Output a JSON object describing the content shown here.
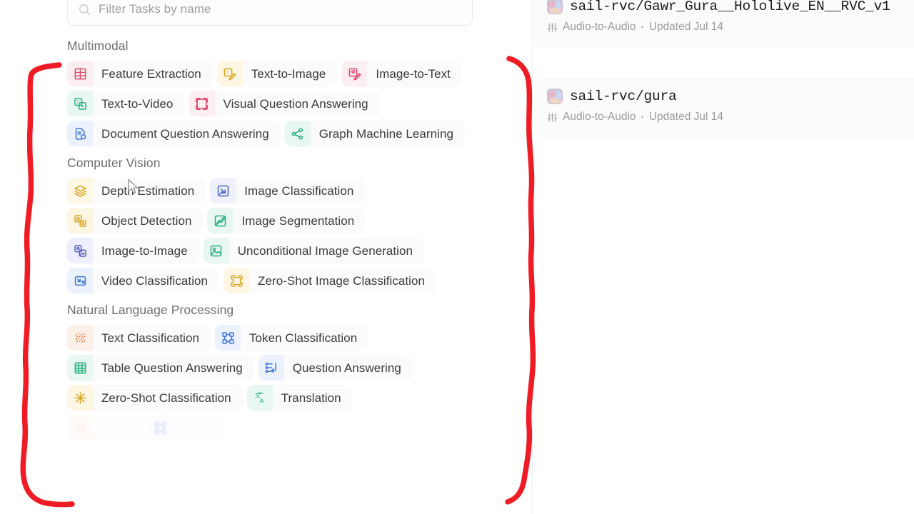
{
  "search": {
    "placeholder": "Filter Tasks by name",
    "value": "",
    "icon": "search-icon"
  },
  "groups": [
    {
      "title": "Multimodal",
      "rows": [
        [
          {
            "label": "Feature Extraction",
            "icon": "table-grid-icon",
            "color": "#d94f6e",
            "bg": "#fceef1"
          },
          {
            "label": "Text-to-Image",
            "icon": "text-to-image-icon",
            "color": "#d9a521",
            "bg": "#fdf6e3"
          },
          {
            "label": "Image-to-Text",
            "icon": "image-to-text-icon",
            "color": "#e0426a",
            "bg": "#fdeef2"
          }
        ],
        [
          {
            "label": "Text-to-Video",
            "icon": "text-to-video-icon",
            "color": "#23b07a",
            "bg": "#e8f8f1"
          },
          {
            "label": "Visual Question Answering",
            "icon": "visual-qa-icon",
            "color": "#e0426a",
            "bg": "#fdeef2"
          }
        ],
        [
          {
            "label": "Document Question Answering",
            "icon": "document-qa-icon",
            "color": "#3f74d6",
            "bg": "#ecf2fd"
          },
          {
            "label": "Graph Machine Learning",
            "icon": "graph-ml-icon",
            "color": "#23b07a",
            "bg": "#e8f8f1"
          }
        ]
      ]
    },
    {
      "title": "Computer Vision",
      "rows": [
        [
          {
            "label": "Depth Estimation",
            "icon": "layers-icon",
            "color": "#e0a21c",
            "bg": "#fdf7e6"
          },
          {
            "label": "Image Classification",
            "icon": "image-classification-icon",
            "color": "#4a63c8",
            "bg": "#eef0fc"
          }
        ],
        [
          {
            "label": "Object Detection",
            "icon": "object-detection-icon",
            "color": "#d9a521",
            "bg": "#fdf6e3"
          },
          {
            "label": "Image Segmentation",
            "icon": "image-segmentation-icon",
            "color": "#23b07a",
            "bg": "#e8f8f1"
          }
        ],
        [
          {
            "label": "Image-to-Image",
            "icon": "image-to-image-icon",
            "color": "#5b5fc7",
            "bg": "#eeeffc"
          },
          {
            "label": "Unconditional Image Generation",
            "icon": "unconditional-image-icon",
            "color": "#23b07a",
            "bg": "#e8f8f1"
          }
        ],
        [
          {
            "label": "Video Classification",
            "icon": "video-classification-icon",
            "color": "#3f74d6",
            "bg": "#ecf2fd"
          },
          {
            "label": "Zero-Shot Image Classification",
            "icon": "zero-shot-image-icon",
            "color": "#d9a521",
            "bg": "#fdf6e3"
          }
        ]
      ]
    },
    {
      "title": "Natural Language Processing",
      "rows": [
        [
          {
            "label": "Text Classification",
            "icon": "text-classification-icon",
            "color": "#e06a2b",
            "bg": "#fdf0e8"
          },
          {
            "label": "Token Classification",
            "icon": "token-classification-icon",
            "color": "#3f74d6",
            "bg": "#ecf2fd"
          }
        ],
        [
          {
            "label": "Table Question Answering",
            "icon": "table-qa-icon",
            "color": "#23b07a",
            "bg": "#e8f8f1"
          },
          {
            "label": "Question Answering",
            "icon": "question-answering-icon",
            "color": "#3f74d6",
            "bg": "#ecf2fd"
          }
        ],
        [
          {
            "label": "Zero-Shot Classification",
            "icon": "zero-shot-icon",
            "color": "#d9a521",
            "bg": "#fdf6e3"
          },
          {
            "label": "Translation",
            "icon": "translation-icon",
            "color": "#23b07a",
            "bg": "#e8f8f1"
          }
        ]
      ]
    }
  ],
  "models": [
    {
      "name": "sail-rvc/Gawr_Gura__Hololive_EN__RVC_v1",
      "avatar": "model-avatar",
      "task": "Audio-to-Audio",
      "task_icon": "sliders-icon",
      "separator": "•",
      "updated": "Updated Jul 14"
    },
    {
      "name": "sail-rvc/gura",
      "avatar": "model-avatar",
      "task": "Audio-to-Audio",
      "task_icon": "sliders-icon",
      "separator": "•",
      "updated": "Updated Jul 14"
    }
  ],
  "annotation": {
    "color": "#ef1c26",
    "left_bracket": "hand-drawn-left-bracket",
    "right_bracket": "hand-drawn-right-bracket"
  }
}
